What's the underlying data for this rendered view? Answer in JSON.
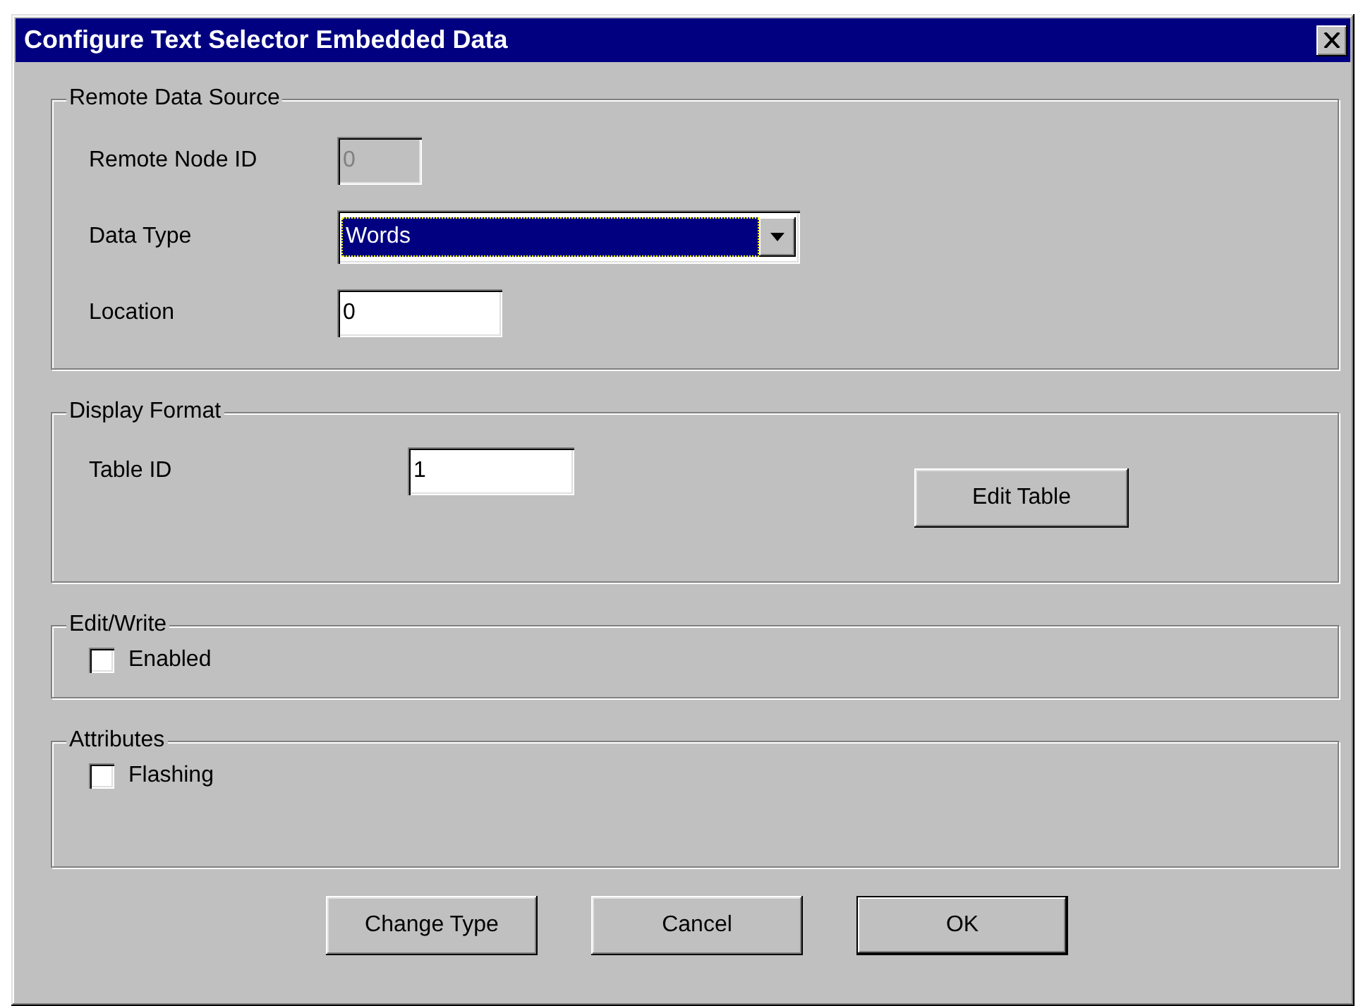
{
  "window": {
    "title": "Configure Text Selector Embedded Data"
  },
  "groups": [
    {
      "title": "Remote Data Source",
      "rows": [
        {
          "kind": "text",
          "label": "Remote Node ID",
          "value": "0",
          "disabled": true
        },
        {
          "kind": "dropdown",
          "label": "Data Type",
          "value": "Words",
          "focused": true
        },
        {
          "kind": "text",
          "label": "Location",
          "value": "0",
          "disabled": false
        }
      ]
    },
    {
      "title": "Display Format",
      "rows": [
        {
          "kind": "text",
          "label": "Table ID",
          "value": "1",
          "disabled": false
        }
      ],
      "button": "Edit Table"
    },
    {
      "title": "Edit/Write",
      "rows": [
        {
          "kind": "checkbox",
          "label": "Enabled",
          "checked": false
        }
      ]
    },
    {
      "title": "Attributes",
      "rows": [
        {
          "kind": "checkbox",
          "label": "Flashing",
          "checked": false
        }
      ]
    }
  ],
  "buttons": [
    {
      "label": "Change Type",
      "default": false
    },
    {
      "label": "Cancel",
      "default": false
    },
    {
      "label": "OK",
      "default": true
    }
  ]
}
